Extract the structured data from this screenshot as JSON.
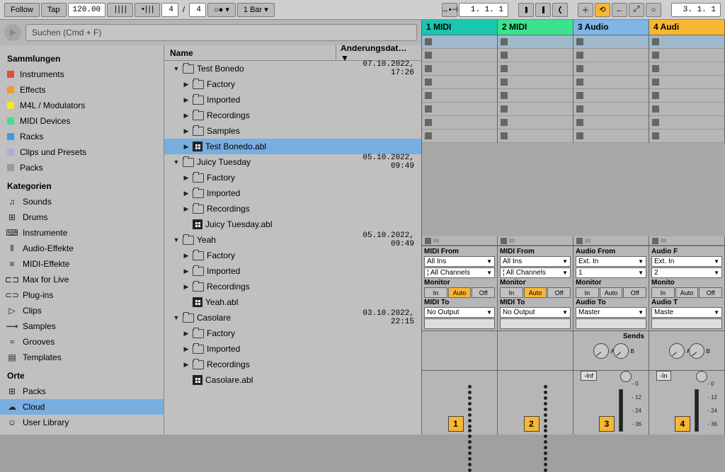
{
  "topbar": {
    "follow": "Follow",
    "tap": "Tap",
    "tempo": "120.00",
    "metronome_glyph": "||||",
    "timesig_dots": "•|||",
    "timesig_num": "4",
    "timesig_sep": "/",
    "timesig_den": "4",
    "punch": "○● ▾",
    "loop_len": "1 Bar ▾",
    "arrow_marker": "→•⊣",
    "position": "1.  1.  1",
    "plus": "＋",
    "link": "⟲",
    "back": "←",
    "fit": "⤢",
    "circle": "○",
    "position2": "3.  1.  1"
  },
  "browser": {
    "search_placeholder": "Suchen (Cmd + F)",
    "sammlungen": "Sammlungen",
    "collections": [
      {
        "label": "Instruments",
        "cls": "sw-red"
      },
      {
        "label": "Effects",
        "cls": "sw-orange"
      },
      {
        "label": "M4L / Modulators",
        "cls": "sw-yellow"
      },
      {
        "label": "MIDI Devices",
        "cls": "sw-green"
      },
      {
        "label": "Racks",
        "cls": "sw-blue"
      },
      {
        "label": "Clips und Presets",
        "cls": "sw-lilac"
      },
      {
        "label": "Packs",
        "cls": "sw-gray"
      }
    ],
    "kategorien": "Kategorien",
    "categories": [
      {
        "label": "Sounds",
        "glyph": "♫"
      },
      {
        "label": "Drums",
        "glyph": "⊞"
      },
      {
        "label": "Instrumente",
        "glyph": "⌨"
      },
      {
        "label": "Audio-Effekte",
        "glyph": "⫴"
      },
      {
        "label": "MIDI-Effekte",
        "glyph": "≡"
      },
      {
        "label": "Max for Live",
        "glyph": "⊏⊐"
      },
      {
        "label": "Plug-ins",
        "glyph": "⊂⊃"
      },
      {
        "label": "Clips",
        "glyph": "▷"
      },
      {
        "label": "Samples",
        "glyph": "⟿"
      },
      {
        "label": "Grooves",
        "glyph": "≈"
      },
      {
        "label": "Templates",
        "glyph": "▤"
      }
    ],
    "orte": "Orte",
    "places": [
      {
        "label": "Packs",
        "glyph": "⊞",
        "sel": false
      },
      {
        "label": "Cloud",
        "glyph": "☁",
        "sel": true
      },
      {
        "label": "User Library",
        "glyph": "☺",
        "sel": false
      }
    ],
    "col_name": "Name",
    "col_date": "Änderungsdat… ▼",
    "rows": [
      {
        "depth": 0,
        "disc": "▼",
        "type": "folder",
        "label": "Test Bonedo",
        "date": "07.10.2022, 17:26",
        "sel": false
      },
      {
        "depth": 1,
        "disc": "▶",
        "type": "folder",
        "label": "Factory",
        "date": "",
        "sel": false
      },
      {
        "depth": 1,
        "disc": "▶",
        "type": "folder",
        "label": "Imported",
        "date": "",
        "sel": false
      },
      {
        "depth": 1,
        "disc": "▶",
        "type": "folder",
        "label": "Recordings",
        "date": "",
        "sel": false
      },
      {
        "depth": 1,
        "disc": "▶",
        "type": "folder",
        "label": "Samples",
        "date": "",
        "sel": false
      },
      {
        "depth": 1,
        "disc": "▶",
        "type": "als",
        "label": "Test Bonedo.abl",
        "date": "",
        "sel": true
      },
      {
        "depth": 0,
        "disc": "▼",
        "type": "folder",
        "label": "Juicy Tuesday",
        "date": "05.10.2022, 09:49",
        "sel": false
      },
      {
        "depth": 1,
        "disc": "▶",
        "type": "folder",
        "label": "Factory",
        "date": "",
        "sel": false
      },
      {
        "depth": 1,
        "disc": "▶",
        "type": "folder",
        "label": "Imported",
        "date": "",
        "sel": false
      },
      {
        "depth": 1,
        "disc": "▶",
        "type": "folder",
        "label": "Recordings",
        "date": "",
        "sel": false
      },
      {
        "depth": 1,
        "disc": "",
        "type": "als",
        "label": "Juicy Tuesday.abl",
        "date": "",
        "sel": false
      },
      {
        "depth": 0,
        "disc": "▼",
        "type": "folder",
        "label": "Yeah",
        "date": "05.10.2022, 09:49",
        "sel": false
      },
      {
        "depth": 1,
        "disc": "▶",
        "type": "folder",
        "label": "Factory",
        "date": "",
        "sel": false
      },
      {
        "depth": 1,
        "disc": "▶",
        "type": "folder",
        "label": "Imported",
        "date": "",
        "sel": false
      },
      {
        "depth": 1,
        "disc": "▶",
        "type": "folder",
        "label": "Recordings",
        "date": "",
        "sel": false
      },
      {
        "depth": 1,
        "disc": "",
        "type": "als",
        "label": "Yeah.abl",
        "date": "",
        "sel": false
      },
      {
        "depth": 0,
        "disc": "▼",
        "type": "folder",
        "label": "Casolare",
        "date": "03.10.2022, 22:15",
        "sel": false
      },
      {
        "depth": 1,
        "disc": "▶",
        "type": "folder",
        "label": "Factory",
        "date": "",
        "sel": false
      },
      {
        "depth": 1,
        "disc": "▶",
        "type": "folder",
        "label": "Imported",
        "date": "",
        "sel": false
      },
      {
        "depth": 1,
        "disc": "▶",
        "type": "folder",
        "label": "Recordings",
        "date": "",
        "sel": false
      },
      {
        "depth": 1,
        "disc": "",
        "type": "als",
        "label": "Casolare.abl",
        "date": "",
        "sel": false
      }
    ]
  },
  "session": {
    "tracks": [
      {
        "name": "1 MIDI",
        "cls": "th-1",
        "from_label": "MIDI From",
        "from_val": "All Ins",
        "ch_prefix": "¦",
        "ch": "All Channels",
        "monitor": "Monitor",
        "mon_active": "Auto",
        "to_label": "MIDI To",
        "to_val": "No Output",
        "num": "1",
        "db": "",
        "sends": false
      },
      {
        "name": "2 MIDI",
        "cls": "th-2",
        "from_label": "MIDI From",
        "from_val": "All Ins",
        "ch_prefix": "¦",
        "ch": "All Channels",
        "monitor": "Monitor",
        "mon_active": "Auto",
        "to_label": "MIDI To",
        "to_val": "No Output",
        "num": "2",
        "db": "",
        "sends": false
      },
      {
        "name": "3 Audio",
        "cls": "th-3",
        "from_label": "Audio From",
        "from_val": "Ext. In",
        "ch_prefix": "",
        "ch": "1",
        "monitor": "Monitor",
        "mon_active": "",
        "to_label": "Audio To",
        "to_val": "Master",
        "num": "3",
        "db": "-Inf",
        "sends": true
      },
      {
        "name": "4 Audi",
        "cls": "th-4",
        "from_label": "Audio F",
        "from_val": "Ext. In",
        "ch_prefix": "",
        "ch": "2",
        "monitor": "Monito",
        "mon_active": "",
        "to_label": "Audio T",
        "to_val": "Maste",
        "num": "4",
        "db": "-In",
        "sends": true
      }
    ],
    "mon_in": "In",
    "mon_auto": "Auto",
    "mon_off": "Off",
    "sends_label": "Sends",
    "knob_a": "A",
    "knob_b": "B",
    "scale": [
      "0",
      "12",
      "24",
      "36"
    ]
  }
}
